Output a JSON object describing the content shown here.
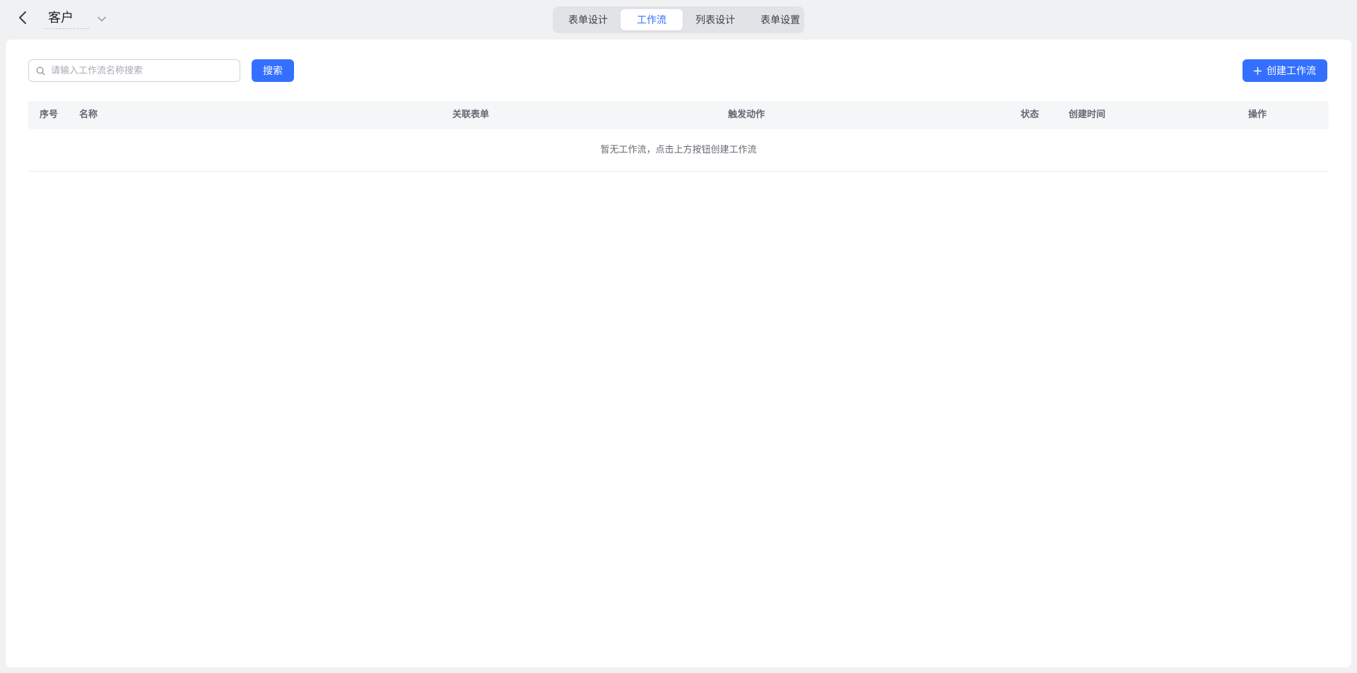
{
  "header": {
    "form_title": "客户",
    "tabs": [
      {
        "label": "表单设计",
        "active": false
      },
      {
        "label": "工作流",
        "active": true
      },
      {
        "label": "列表设计",
        "active": false
      },
      {
        "label": "表单设置",
        "active": false
      }
    ]
  },
  "toolbar": {
    "search_placeholder": "请输入工作流名称搜索",
    "search_value": "",
    "search_label": "搜索",
    "create_label": "创建工作流"
  },
  "table": {
    "columns": [
      "序号",
      "名称",
      "关联表单",
      "触发动作",
      "状态",
      "创建时间",
      "操作"
    ],
    "rows": [],
    "empty_text": "暂无工作流，点击上方按钮创建工作流"
  },
  "colors": {
    "accent": "#3370ff",
    "background": "#f0f1f3",
    "card": "#ffffff"
  },
  "icons": {
    "back": "chevron-left-icon",
    "title_dropdown": "chevron-down-icon",
    "search": "search-icon",
    "create": "plus-icon"
  }
}
